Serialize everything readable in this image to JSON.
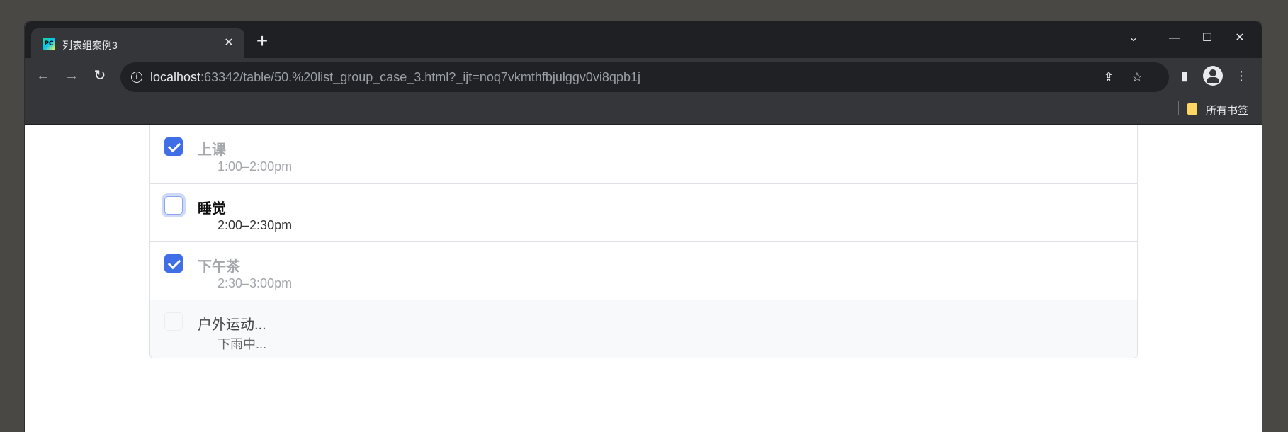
{
  "browser": {
    "tab_title": "列表组案例3",
    "favicon_text": "PC",
    "tab_close": "✕",
    "new_tab": "+",
    "url_host": "localhost",
    "url_rest": ":63342/table/50.%20list_group_case_3.html?_ijt=noq7vkmthfbjulggv0vi8qpb1j",
    "bookmarks_folder": "所有书签",
    "controls": {
      "tab_search": "⌄",
      "minimize": "—",
      "maximize": "☐",
      "close": "✕"
    },
    "nav": {
      "back": "←",
      "forward": "→",
      "reload": "↻"
    },
    "icons": {
      "share": "⇪",
      "star": "☆",
      "sidepanel": "▮",
      "menu": "⋮",
      "info": "i"
    }
  },
  "list": {
    "items": [
      {
        "title": "上课",
        "time": "1:00–2:00pm",
        "checked": true,
        "state": "done"
      },
      {
        "title": "睡觉",
        "time": "2:00–2:30pm",
        "checked": false,
        "state": "focused"
      },
      {
        "title": "下午茶",
        "time": "2:30–3:00pm",
        "checked": true,
        "state": "done"
      },
      {
        "title": "户外运动...",
        "time": "下雨中...",
        "checked": false,
        "state": "disabled"
      }
    ]
  },
  "colors": {
    "checkbox_checked": "#3f6ee6",
    "done_text": "#a3a6aa",
    "border": "#dee2e6",
    "disabled_bg": "#f8f9fa"
  }
}
